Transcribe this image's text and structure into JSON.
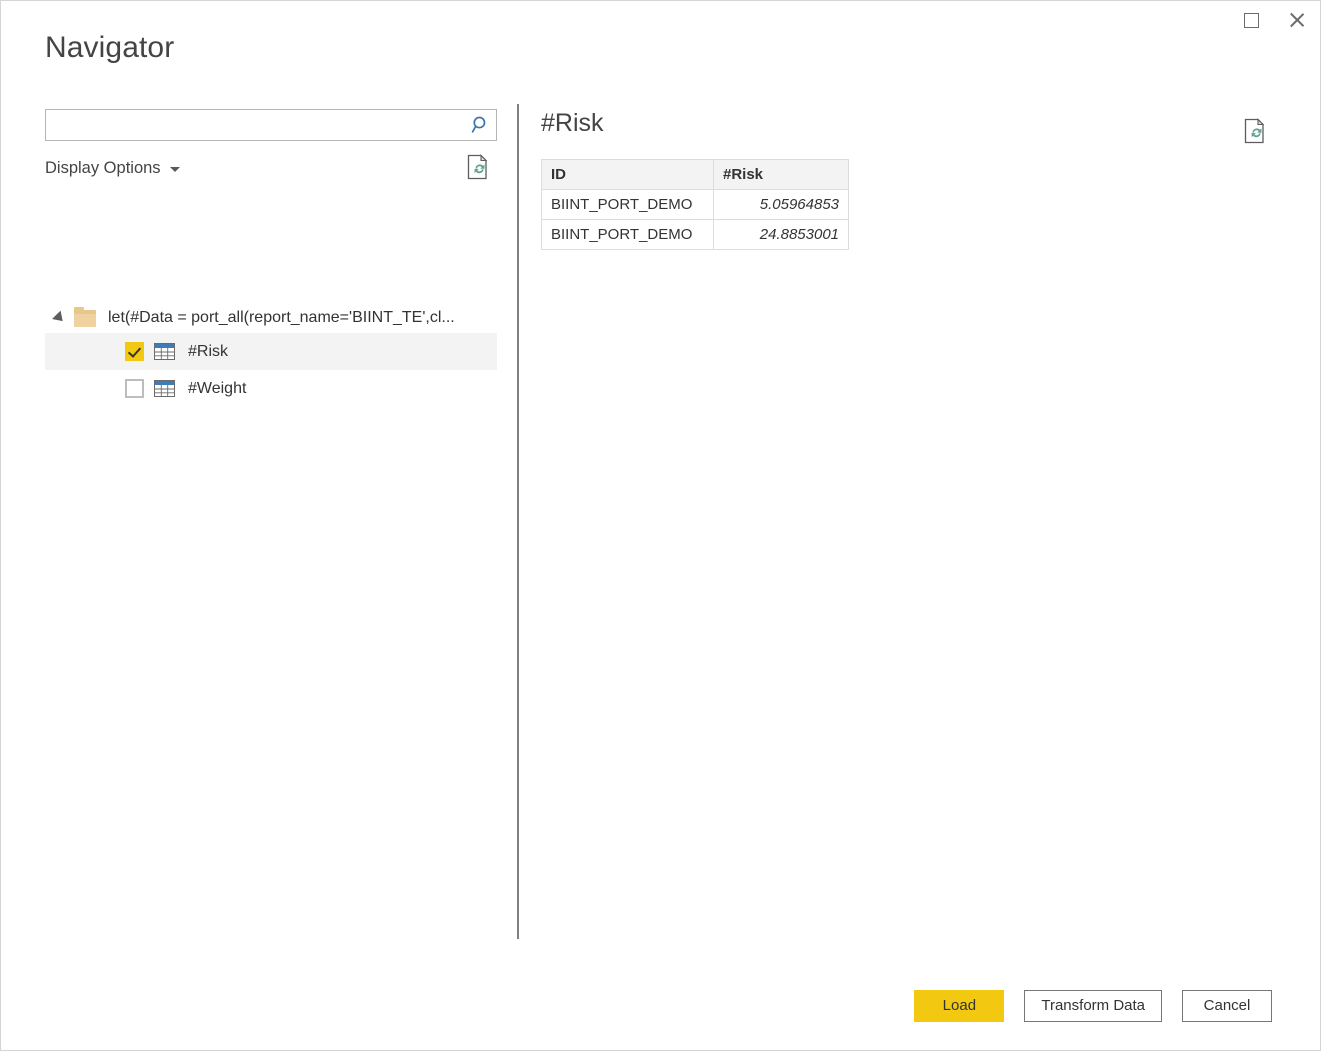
{
  "window": {
    "title": "Navigator",
    "controls": [
      {
        "name": "maximize",
        "icon": "maximize-icon"
      },
      {
        "name": "close",
        "icon": "close-icon"
      }
    ]
  },
  "left_pane": {
    "search": {
      "value": "",
      "placeholder": "",
      "icon": "search-icon"
    },
    "display_options": {
      "label": "Display Options",
      "caret_icon": "chevron-down-icon"
    },
    "refresh_icon": "refresh-document-icon",
    "tree": {
      "root": {
        "label": "let(#Data = port_all(report_name='BIINT_TE',cl...",
        "expanded": true,
        "icon": "folder-icon"
      },
      "items": [
        {
          "label": "#Risk",
          "checked": true,
          "selected": true,
          "icon": "table-icon"
        },
        {
          "label": "#Weight",
          "checked": false,
          "selected": false,
          "icon": "table-icon"
        }
      ]
    }
  },
  "right_pane": {
    "preview_title": "#Risk",
    "refresh_icon": "refresh-document-icon",
    "table": {
      "columns": [
        "ID",
        "#Risk"
      ],
      "rows": [
        {
          "id": "BIINT_PORT_DEMO",
          "risk": "5.05964853"
        },
        {
          "id": "BIINT_PORT_DEMO",
          "risk": "24.8853001"
        }
      ]
    }
  },
  "footer": {
    "load_label": "Load",
    "transform_label": "Transform Data",
    "cancel_label": "Cancel"
  },
  "colors": {
    "accent": "#f2c811",
    "search_icon": "#3c74b0",
    "refresh_green": "#61a392",
    "folder": "#e8c88a",
    "divider": "#808080",
    "table_header_bg": "#f3f3f3"
  }
}
